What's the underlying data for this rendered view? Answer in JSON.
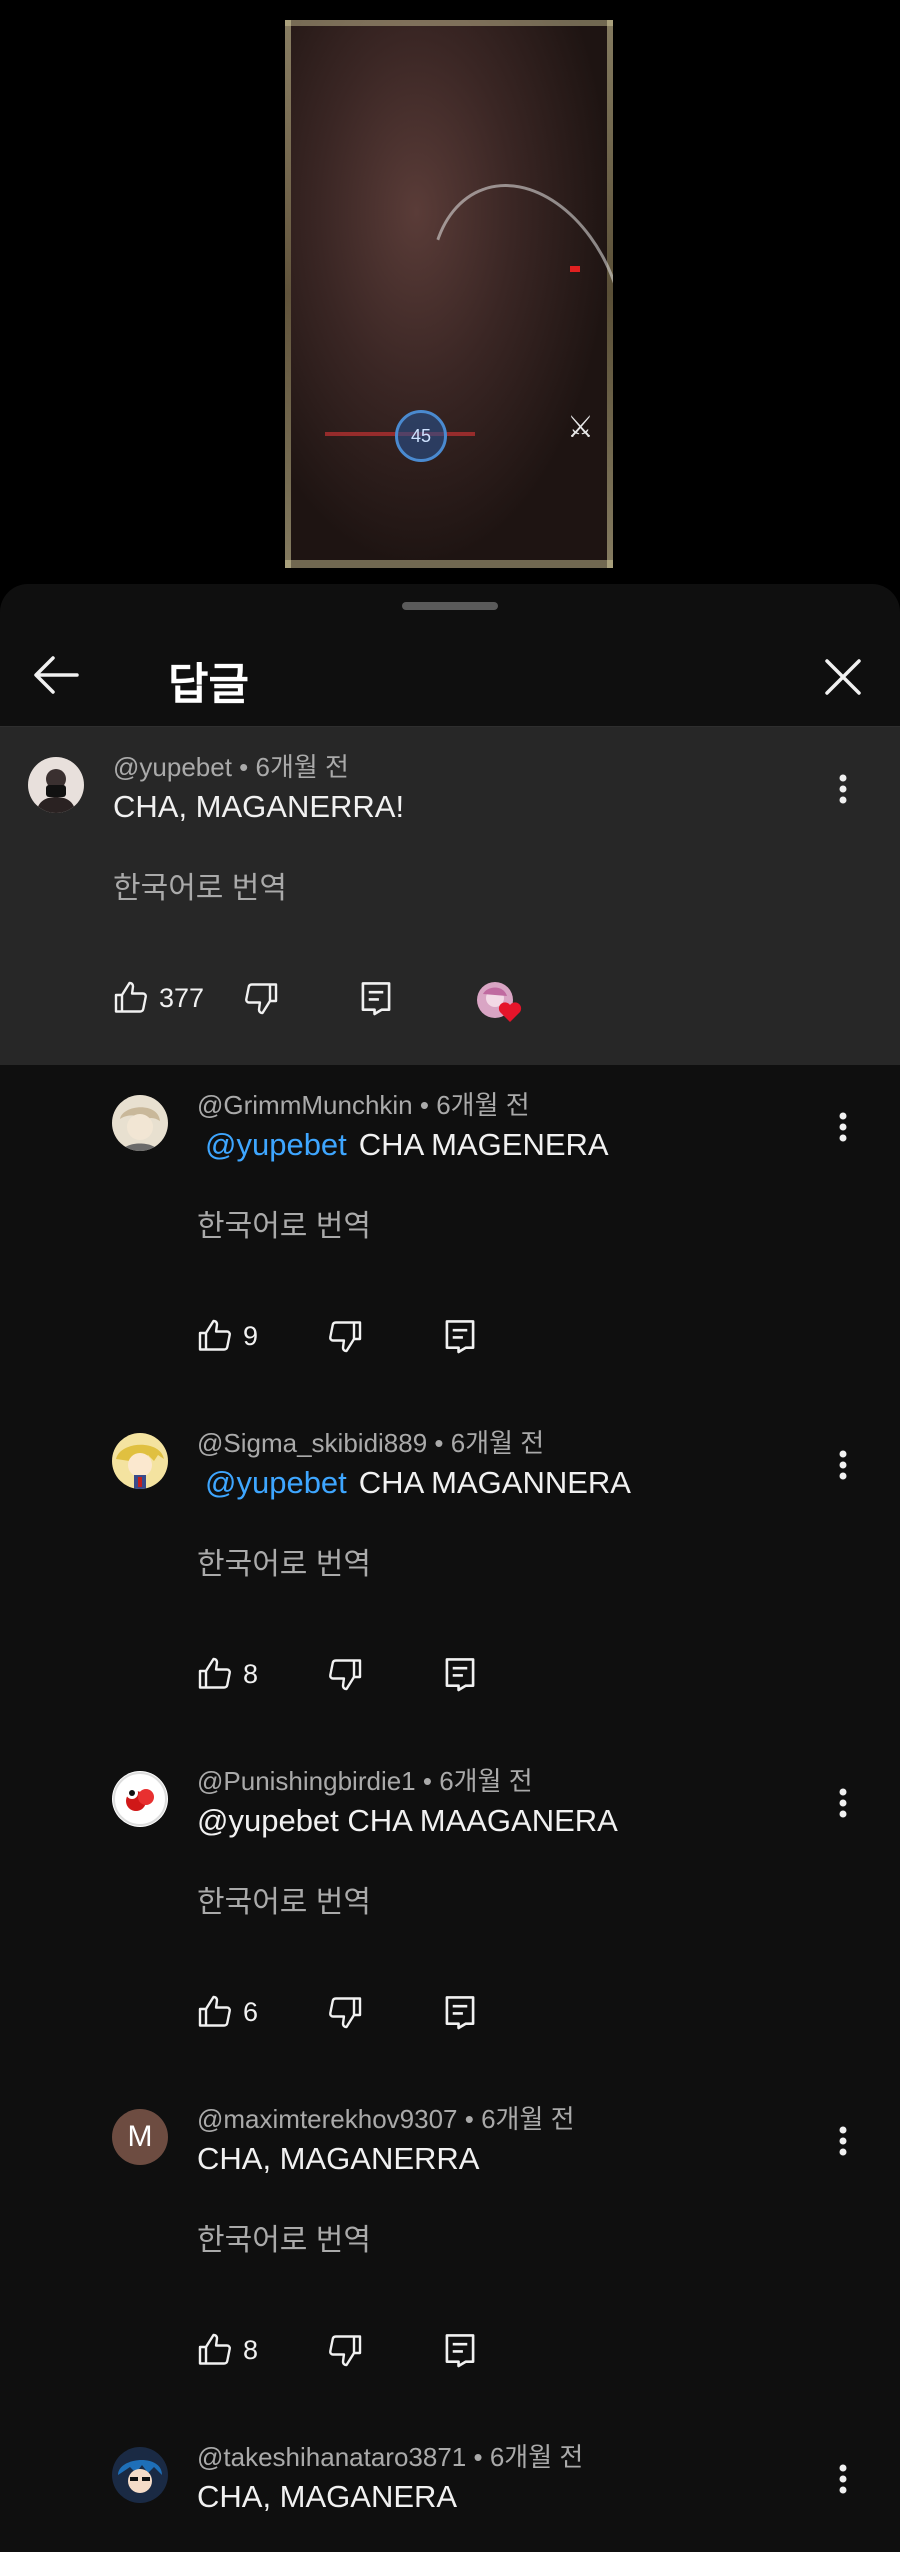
{
  "sheet": {
    "title": "답글"
  },
  "parent": {
    "author": "@yupebet",
    "time": "6개월 전",
    "text": "CHA, MAGANERRA!",
    "translate": "한국어로 번역",
    "likes": "377"
  },
  "replies": [
    {
      "author": "@GrimmMunchkin",
      "time": "6개월 전",
      "mention": "@yupebet",
      "text": "CHA MAGENERA",
      "translate": "한국어로 번역",
      "likes": "9"
    },
    {
      "author": "@Sigma_skibidi889",
      "time": "6개월 전",
      "mention": "@yupebet",
      "text": "CHA MAGANNERA",
      "translate": "한국어로 번역",
      "likes": "8"
    },
    {
      "author": "@Punishingbirdie1",
      "time": "6개월 전",
      "mention": "",
      "text": "@yupebet CHA MAAGANERA",
      "translate": "한국어로 번역",
      "likes": "6"
    },
    {
      "author": "@maximterekhov9307",
      "time": "6개월 전",
      "mention": "",
      "text": "CHA, MAGANERRA",
      "translate": "한국어로 번역",
      "likes": "8",
      "avatar_letter": "M"
    },
    {
      "author": "@takeshihanataro3871",
      "time": "6개월 전",
      "mention": "",
      "text": "CHA, MAGANERA"
    }
  ],
  "video": {
    "overlay_badge": "45"
  },
  "colors": {
    "accent": "#3ea6ff",
    "sheet_bg": "#0f0f0f",
    "parent_bg": "#272727"
  }
}
